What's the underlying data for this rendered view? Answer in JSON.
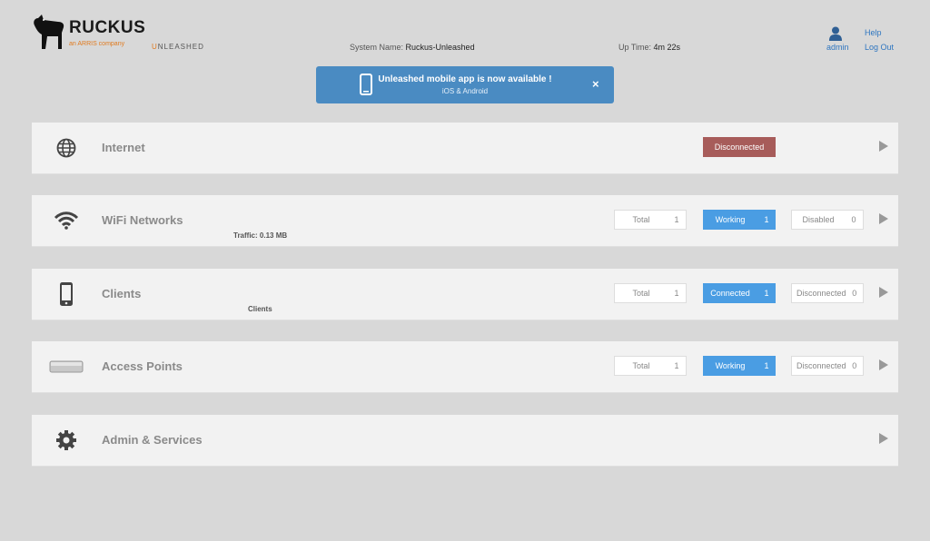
{
  "brand": {
    "name": "RUCKUS",
    "subtitle": "an ARRIS company",
    "product_prefix": "U",
    "product": "NLEASHED"
  },
  "header": {
    "system_name_label": "System Name:",
    "system_name": "Ruckus-Unleashed",
    "uptime_label": "Up Time:",
    "uptime": "4m 22s",
    "user": "admin",
    "help": "Help",
    "logout": "Log Out"
  },
  "banner": {
    "title": "Unleashed mobile app is now available !",
    "subtitle": "iOS & Android",
    "close": "×"
  },
  "panels": {
    "internet": {
      "label": "Internet",
      "status": "Disconnected"
    },
    "wifi": {
      "label": "WiFi Networks",
      "sub": "Traffic: 0.13 MB",
      "total_label": "Total",
      "total": "1",
      "working_label": "Working",
      "working": "1",
      "disabled_label": "Disabled",
      "disabled": "0"
    },
    "clients": {
      "label": "Clients",
      "sub": "Clients",
      "total_label": "Total",
      "total": "1",
      "connected_label": "Connected",
      "connected": "1",
      "disconnected_label": "Disconnected",
      "disconnected": "0"
    },
    "aps": {
      "label": "Access Points",
      "total_label": "Total",
      "total": "1",
      "working_label": "Working",
      "working": "1",
      "disconnected_label": "Disconnected",
      "disconnected": "0"
    },
    "admin": {
      "label": "Admin & Services"
    }
  },
  "colors": {
    "accent": "#4a9de3",
    "banner": "#4a8bc2",
    "danger": "#a75c5a",
    "brand_orange": "#e07a1f",
    "link": "#2f76c0"
  },
  "icons": [
    "dog-logo-icon",
    "user-icon",
    "phone-icon",
    "close-icon",
    "globe-icon",
    "wifi-icon",
    "smartphone-icon",
    "access-point-icon",
    "gear-icon",
    "chevron-right-icon"
  ]
}
